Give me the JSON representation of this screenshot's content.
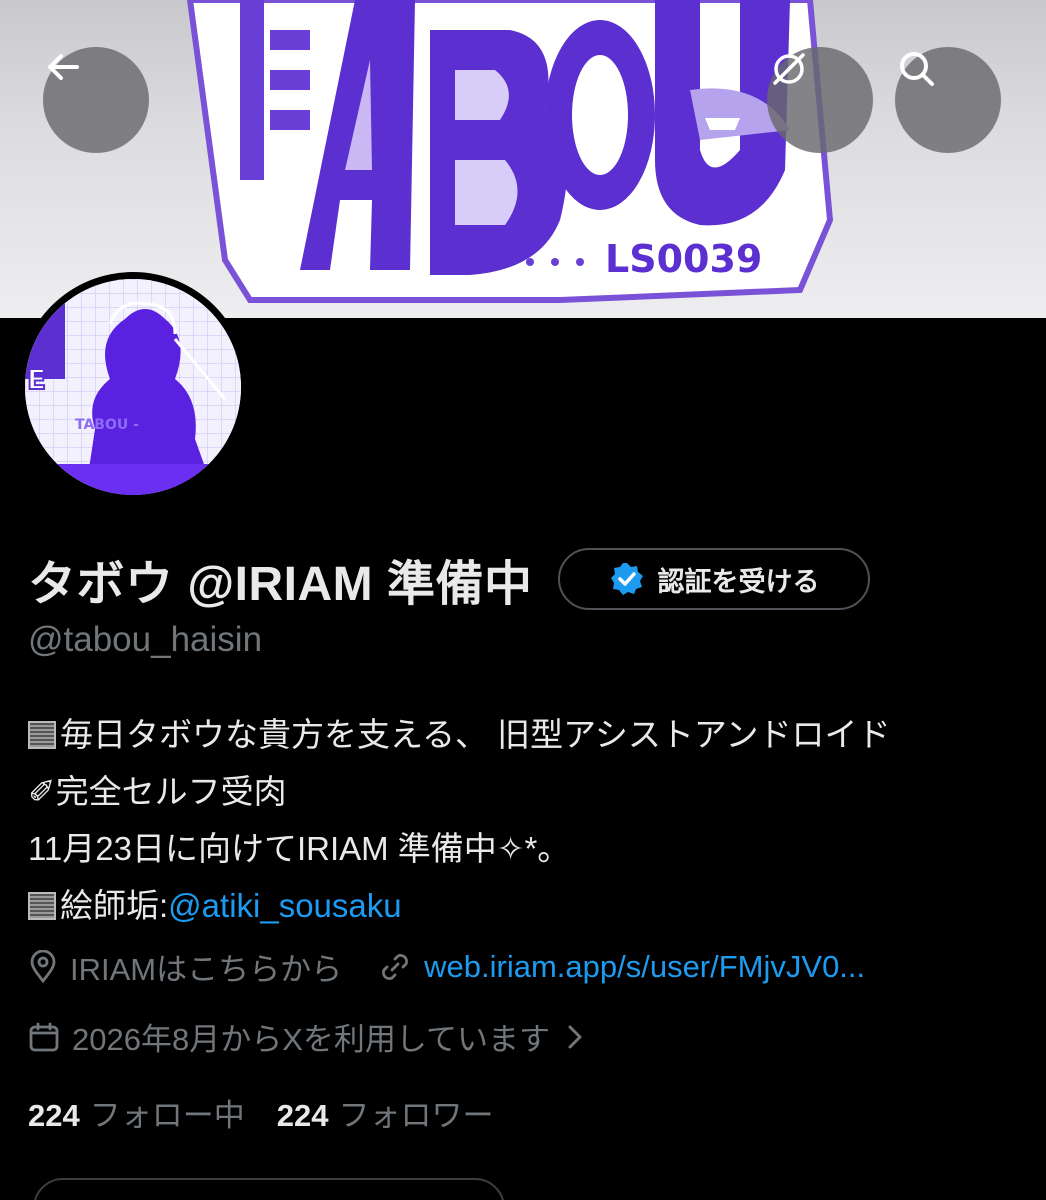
{
  "banner": {
    "logo_text": "TABOU",
    "logo_sub": "・・・LS0039"
  },
  "header": {
    "back_icon": "arrow-left-icon",
    "grok_icon": "grok-icon",
    "search_icon": "search-icon"
  },
  "avatar": {
    "watermark": "TABOU -"
  },
  "profile": {
    "display_name": "タボウ @IRIAM 準備中",
    "verify_label": "認証を受ける",
    "handle": "@tabou_haisin"
  },
  "bio": {
    "line1": "毎日タボウな貴方を支える、 旧型アシストアンドロイド",
    "line2_emoji": "✐",
    "line2": "完全セルフ受肉",
    "line3": "11月23日に向けてIRIAM 準備中✧*。",
    "line4_prefix": "絵師垢:",
    "line4_link": "@atiki_sousaku"
  },
  "meta": {
    "location": "IRIAMはこちらから",
    "url": "web.iriam.app/s/user/FMjvJV0...",
    "joined": "2026年8月からXを利用しています"
  },
  "stats": {
    "following_count": "224",
    "following_label": "フォロー中",
    "followers_count": "224",
    "followers_label": "フォロワー"
  },
  "colors": {
    "accent": "#1d9bf0",
    "muted": "#71767b",
    "text": "#e7e9ea",
    "brand_purple": "#6a3fd8"
  }
}
